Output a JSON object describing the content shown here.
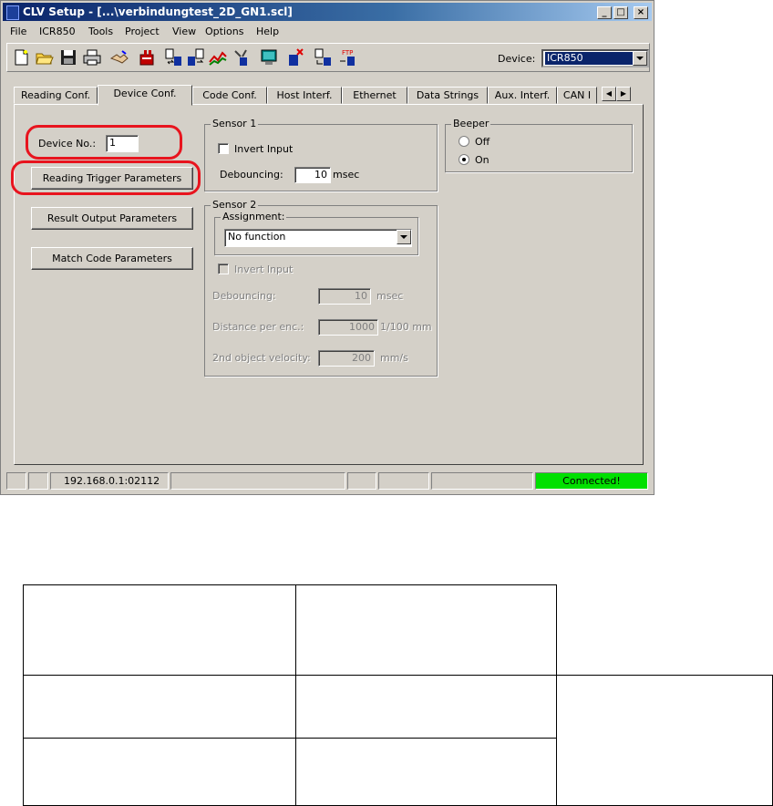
{
  "window": {
    "title": "CLV Setup - [...\\verbindungtest_2D_GN1.scl]",
    "controls": {
      "minimize": "_",
      "maximize": "□",
      "close": "×"
    }
  },
  "menu": [
    "File",
    "ICR850",
    "Tools",
    "Project",
    "View",
    "Options",
    "Help"
  ],
  "toolbar": {
    "device_label": "Device:",
    "device_value": "ICR850",
    "icons": [
      "new-file-icon",
      "open-folder-icon",
      "save-icon",
      "print-icon",
      "handshake-icon",
      "device-config-icon",
      "upload-icon",
      "download-icon",
      "chart-icon",
      "wrench-icon",
      "monitor-icon",
      "run-icon",
      "transfer-icon",
      "ftp-icon"
    ]
  },
  "tabs": [
    "Reading Conf.",
    "Device Conf.",
    "Code Conf.",
    "Host Interf.",
    "Ethernet",
    "Data Strings",
    "Aux. Interf.",
    "CAN I"
  ],
  "active_tab": "Device Conf.",
  "device": {
    "no_label": "Device No.:",
    "no_value": "1",
    "buttons": [
      "Reading Trigger Parameters",
      "Result Output Parameters",
      "Match Code Parameters"
    ]
  },
  "sensor1": {
    "title": "Sensor 1",
    "invert_label": "Invert Input",
    "debouncing_label": "Debouncing:",
    "debouncing_value": "10",
    "debouncing_unit": "msec"
  },
  "sensor2": {
    "title": "Sensor 2",
    "assignment_label": "Assignment:",
    "assignment_value": "No function",
    "invert_label": "Invert Input",
    "debouncing_label": "Debouncing:",
    "debouncing_value": "10",
    "debouncing_unit": "msec",
    "distance_label": "Distance per enc.:",
    "distance_value": "1000",
    "distance_unit": "1/100 mm",
    "velocity_label": "2nd object velocity:",
    "velocity_value": "200",
    "velocity_unit": "mm/s"
  },
  "beeper": {
    "title": "Beeper",
    "off_label": "Off",
    "on_label": "On",
    "selected": "On"
  },
  "status": {
    "address": "192.168.0.1:02112",
    "connection": "Connected!"
  },
  "colors": {
    "highlight": "#e8141e",
    "connected": "#00e000",
    "titlebar": "#0a246a"
  }
}
